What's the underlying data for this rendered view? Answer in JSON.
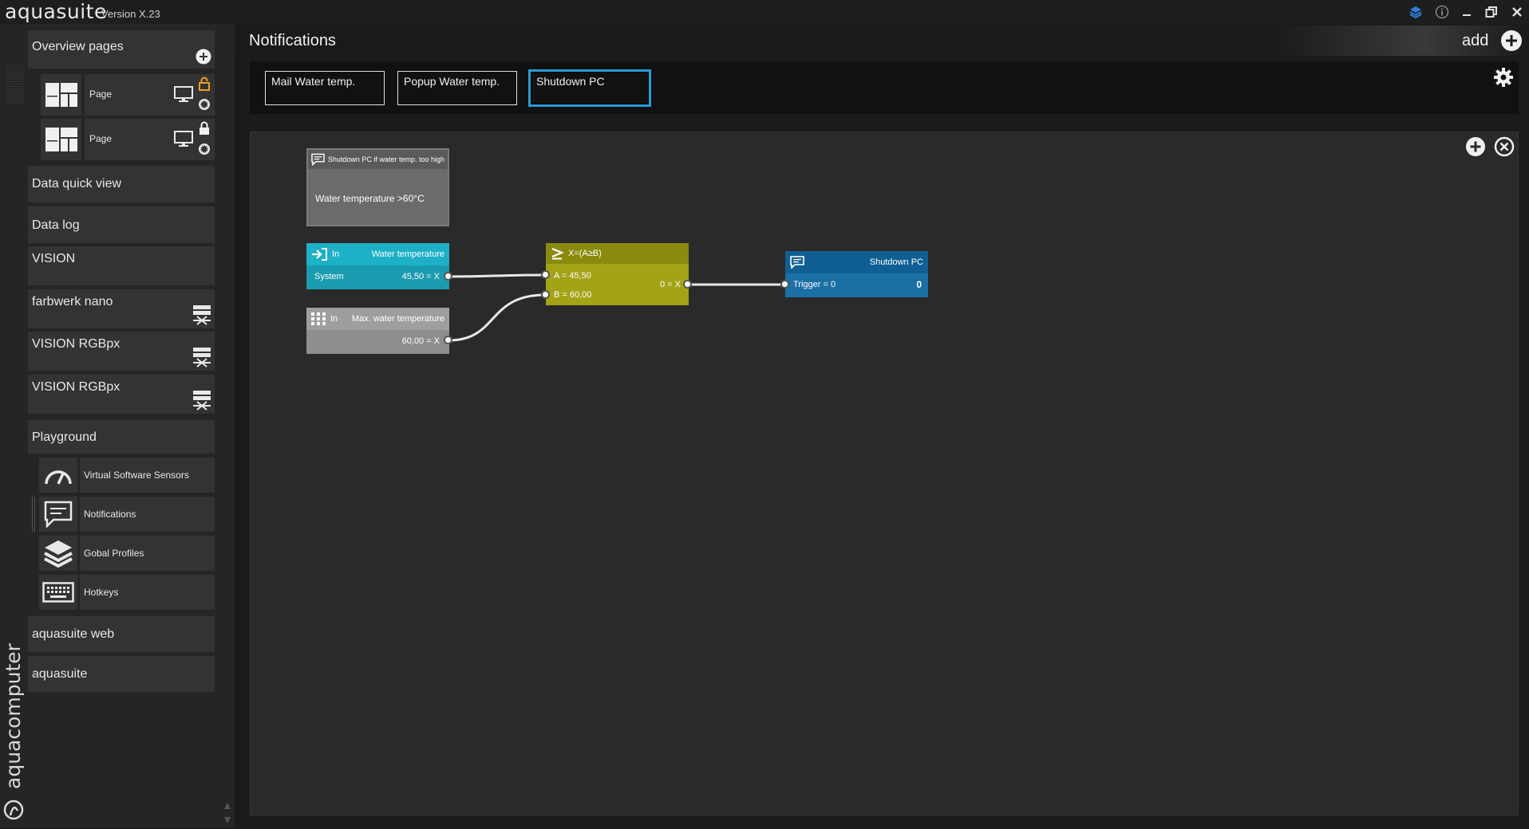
{
  "app": {
    "name": "aquasuite",
    "version": "Version X.23",
    "vendor": "aquacomputer"
  },
  "sidebar": {
    "overview_pages": "Overview pages",
    "pages": [
      {
        "label": "Page",
        "lock_color": "#f0a020"
      },
      {
        "label": "Page",
        "lock_color": "#ffffff"
      }
    ],
    "items": [
      {
        "label": "Data quick view"
      },
      {
        "label": "Data log"
      },
      {
        "label": "VISION"
      },
      {
        "label": "farbwerk nano"
      },
      {
        "label": "VISION RGBpx"
      },
      {
        "label": "VISION RGBpx"
      },
      {
        "label": "Playground"
      }
    ],
    "playground_items": [
      {
        "label": "Virtual Software Sensors",
        "icon": "gauge-icon"
      },
      {
        "label": "Notifications",
        "icon": "message-icon"
      },
      {
        "label": "Gobal Profiles",
        "icon": "layers-icon"
      },
      {
        "label": "Hotkeys",
        "icon": "keyboard-icon"
      }
    ],
    "bottom_items": [
      {
        "label": "aquasuite web"
      },
      {
        "label": "aquasuite"
      }
    ]
  },
  "header": {
    "title": "Notifications",
    "add_label": "add"
  },
  "tabs": [
    {
      "label": "Mail Water temp.",
      "active": false
    },
    {
      "label": "Popup Water temp.",
      "active": false
    },
    {
      "label": "Shutdown PC",
      "active": true
    }
  ],
  "nodes": {
    "comment": {
      "title": "Shutdown PC if water temp. too high",
      "body": "Water temperature >60°C"
    },
    "water_temp": {
      "kind": "In",
      "name": "Water temperature",
      "source": "System",
      "value": "45,50 = X",
      "color": "#1aa6b9"
    },
    "max_temp": {
      "kind": "In",
      "name": "Max. water temperature",
      "value": "60,00 = X",
      "color": "#9a9a9a"
    },
    "compare": {
      "formula": "X=(A≥B)",
      "input_a": "A = 45,50",
      "input_b": "B = 60,00",
      "output": "0 = X",
      "color": "#a5a516"
    },
    "shutdown": {
      "name": "Shutdown PC",
      "trigger": "Trigger = 0",
      "value": "0",
      "color": "#1873a8"
    }
  },
  "colors": {
    "accent": "#2a9bd8",
    "lock_open": "#f0a020"
  }
}
